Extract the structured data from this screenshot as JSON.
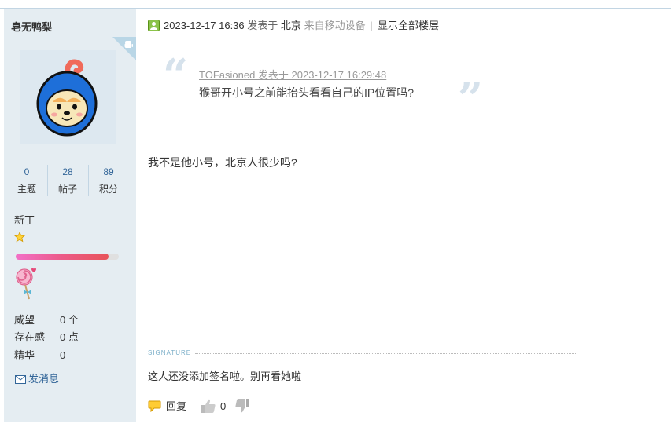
{
  "user": {
    "name": "皂无鸭梨",
    "stats": [
      {
        "value": "0",
        "label": "主题"
      },
      {
        "value": "28",
        "label": "帖子"
      },
      {
        "value": "89",
        "label": "积分"
      }
    ],
    "rank": "新丁",
    "level_progress": 0.9,
    "info": [
      {
        "key": "威望",
        "value": "0 个"
      },
      {
        "key": "存在感",
        "value": "0 点"
      },
      {
        "key": "精华",
        "value": "0"
      }
    ],
    "send_message_label": "发消息"
  },
  "post": {
    "time": "2023-12-17 16:36",
    "posted_in_label": "发表于",
    "location": "北京",
    "device": "来自移动设备",
    "show_all_floors": "显示全部楼层",
    "quote": {
      "author_line": "TOFasioned 发表于 2023-12-17 16:29:48",
      "text": "猴哥开小号之前能抬头看看自己的IP位置吗?"
    },
    "body": "我不是他小号，北京人很少吗?",
    "signature_label": "SIGNATURE",
    "signature": "这人还没添加签名啦。别再看她啦"
  },
  "actions": {
    "reply_label": "回复",
    "like_count": "0"
  },
  "colors": {
    "sidebar_bg": "#e5edf2",
    "border": "#c2d5e3",
    "link": "#336699",
    "progress_start": "#f270c8",
    "progress_end": "#e8545a"
  },
  "icons": [
    "online-status-icon",
    "android-badge-icon",
    "star-icon",
    "lollipop-medal-icon",
    "envelope-icon",
    "reply-bubble-icon",
    "thumbs-up-icon",
    "thumbs-down-icon"
  ]
}
